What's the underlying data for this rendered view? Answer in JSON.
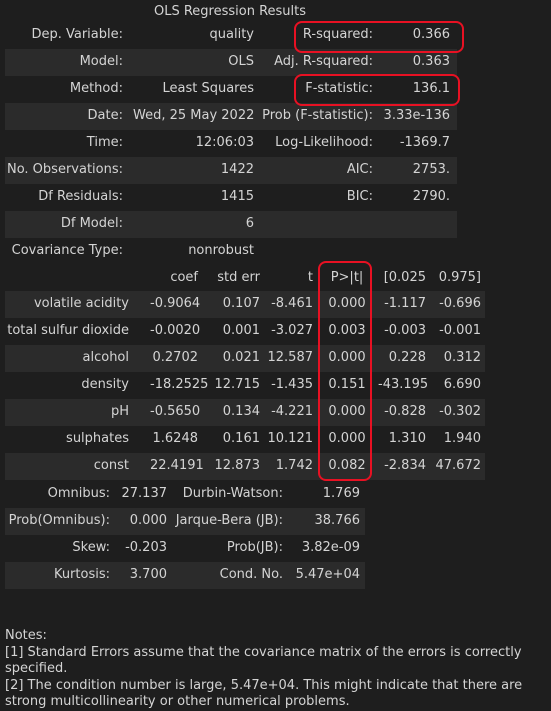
{
  "title": "OLS Regression Results",
  "summary": [
    {
      "l1": "Dep. Variable:",
      "v1": "quality",
      "l2": "R-squared:",
      "v2": "0.366"
    },
    {
      "l1": "Model:",
      "v1": "OLS",
      "l2": "Adj. R-squared:",
      "v2": "0.363"
    },
    {
      "l1": "Method:",
      "v1": "Least Squares",
      "l2": "F-statistic:",
      "v2": "136.1"
    },
    {
      "l1": "Date:",
      "v1": "Wed, 25 May 2022",
      "l2": "Prob (F-statistic):",
      "v2": "3.33e-136"
    },
    {
      "l1": "Time:",
      "v1": "12:06:03",
      "l2": "Log-Likelihood:",
      "v2": "-1369.7"
    },
    {
      "l1": "No. Observations:",
      "v1": "1422",
      "l2": "AIC:",
      "v2": "2753."
    },
    {
      "l1": "Df Residuals:",
      "v1": "1415",
      "l2": "BIC:",
      "v2": "2790."
    },
    {
      "l1": "Df Model:",
      "v1": "6",
      "l2": "",
      "v2": ""
    },
    {
      "l1": "Covariance Type:",
      "v1": "nonrobust",
      "l2": "",
      "v2": ""
    }
  ],
  "coef_header": [
    "coef",
    "std err",
    "t",
    "P>|t|",
    "[0.025",
    "0.975]"
  ],
  "coef_rows": [
    {
      "name": "volatile acidity",
      "vals": [
        "-0.9064",
        "0.107",
        "-8.461",
        "0.000",
        "-1.117",
        "-0.696"
      ]
    },
    {
      "name": "total sulfur dioxide",
      "vals": [
        "-0.0020",
        "0.001",
        "-3.027",
        "0.003",
        "-0.003",
        "-0.001"
      ]
    },
    {
      "name": "alcohol",
      "vals": [
        "0.2702",
        "0.021",
        "12.587",
        "0.000",
        "0.228",
        "0.312"
      ]
    },
    {
      "name": "density",
      "vals": [
        "-18.2525",
        "12.715",
        "-1.435",
        "0.151",
        "-43.195",
        "6.690"
      ]
    },
    {
      "name": "pH",
      "vals": [
        "-0.5650",
        "0.134",
        "-4.221",
        "0.000",
        "-0.828",
        "-0.302"
      ]
    },
    {
      "name": "sulphates",
      "vals": [
        "1.6248",
        "0.161",
        "10.121",
        "0.000",
        "1.310",
        "1.940"
      ]
    },
    {
      "name": "const",
      "vals": [
        "22.4191",
        "12.873",
        "1.742",
        "0.082",
        "-2.834",
        "47.672"
      ]
    }
  ],
  "diagnostics": [
    {
      "l1": "Omnibus:",
      "v1": "27.137",
      "l2": "Durbin-Watson:",
      "v2": "1.769"
    },
    {
      "l1": "Prob(Omnibus):",
      "v1": "0.000",
      "l2": "Jarque-Bera (JB):",
      "v2": "38.766"
    },
    {
      "l1": "Skew:",
      "v1": "-0.203",
      "l2": "Prob(JB):",
      "v2": "3.82e-09"
    },
    {
      "l1": "Kurtosis:",
      "v1": "3.700",
      "l2": "Cond. No.",
      "v2": "5.47e+04"
    }
  ],
  "notes": [
    "Notes:",
    "[1] Standard Errors assume that the covariance matrix of the errors is correctly specified.",
    "[2] The condition number is large, 5.47e+04. This might indicate that there are",
    "strong multicollinearity or other numerical problems."
  ],
  "colors": {
    "background": "#1e1e1e",
    "band": "#2b2b2b",
    "highlight": "#e81123",
    "text": "#d4d4d4"
  }
}
